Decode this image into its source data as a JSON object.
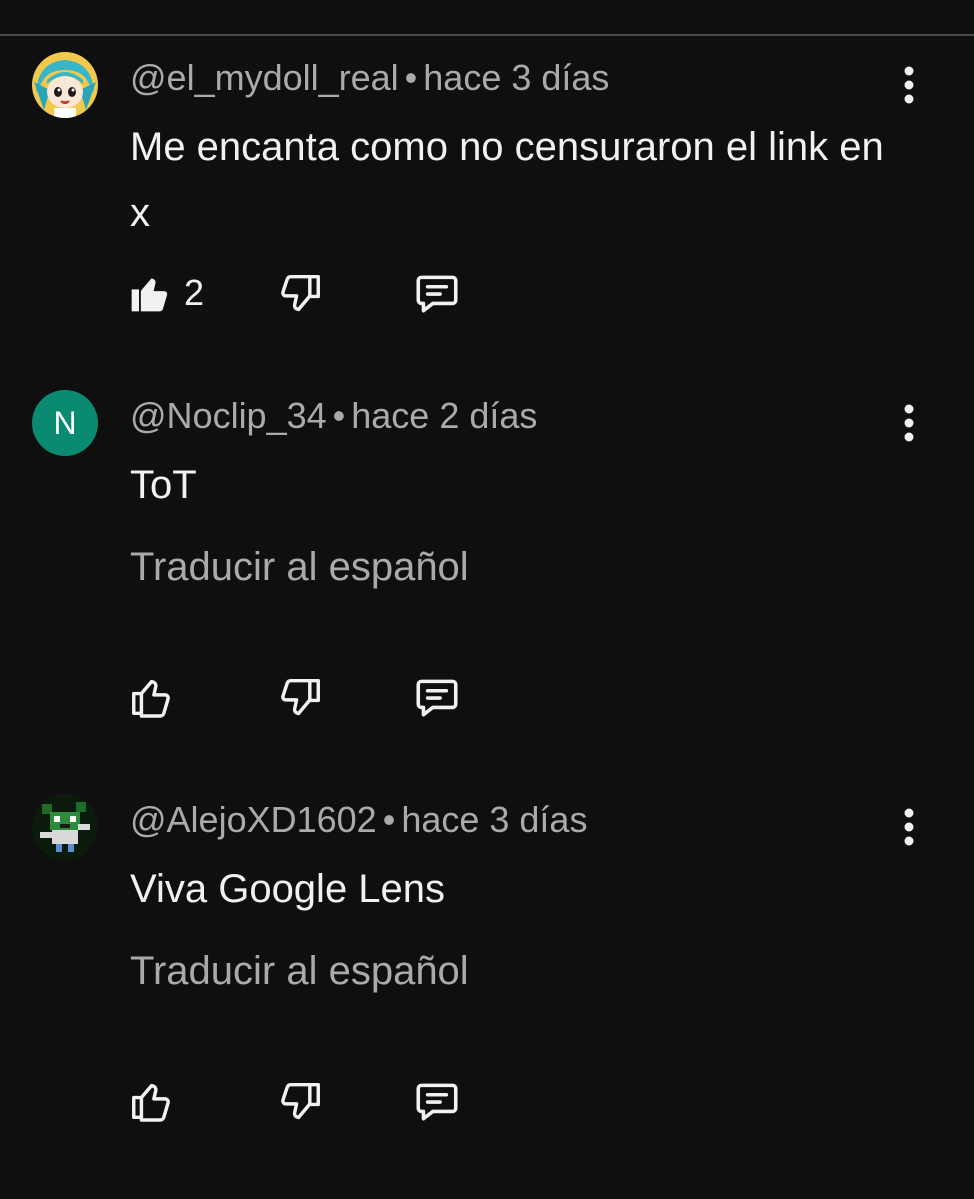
{
  "comments": [
    {
      "author": "@el_mydoll_real",
      "separator": "•",
      "time": "hace 3 días",
      "text": "Me encanta como no censuraron el link en x",
      "translate": "",
      "like_count": "2",
      "liked": true,
      "avatar_icon": "anime-character-avatar-icon"
    },
    {
      "author": "@Noclip_34",
      "separator": "•",
      "time": "hace 2 días",
      "text": "ToT",
      "translate": "Traducir al español",
      "like_count": "",
      "liked": false,
      "avatar_letter": "N",
      "avatar_color": "#0b8a72"
    },
    {
      "author": "@AlejoXD1602",
      "separator": "•",
      "time": "hace 3 días",
      "text": "Viva Google Lens",
      "translate": "Traducir al español",
      "like_count": "",
      "liked": false,
      "avatar_icon": "pixel-art-avatar-icon"
    }
  ],
  "colors": {
    "background": "#0f0f0f",
    "primary_text": "#f1f1f1",
    "secondary_text": "#aaaaaa",
    "divider": "#4a4a4a"
  }
}
